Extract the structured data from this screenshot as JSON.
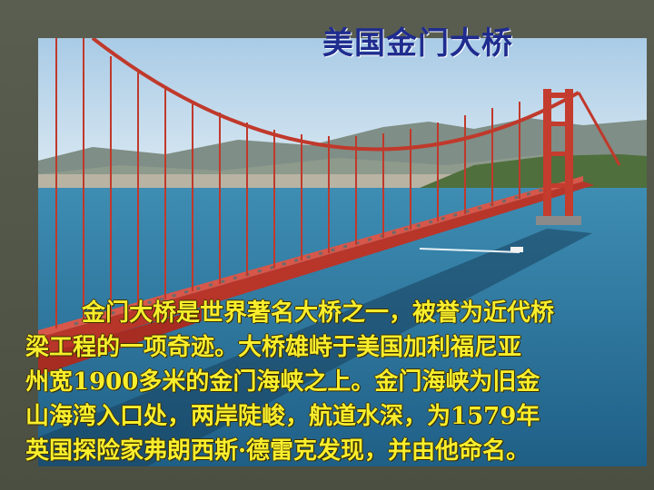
{
  "slide": {
    "title": "美国金门大桥",
    "paragraph_lines": [
      "金门大桥是世界著名大桥之一，被誉为近代桥",
      "梁工程的一项奇迹。大桥雄峙于美国加利福尼亚",
      "州宽1900多米的金门海峡之上。金门海峡为旧金",
      "山海湾入口处，两岸陡峻，航道水深，为1579年",
      "英国探险家弗朗西斯·德雷克发现，并由他命名。"
    ]
  },
  "colors": {
    "title": "#1f2c8f",
    "body_text": "#f8ee2c",
    "background": "#4f5346",
    "bridge_red": "#c0392b",
    "water": "#2f7fa6"
  },
  "photo": {
    "subject": "golden-gate-bridge-photo"
  }
}
